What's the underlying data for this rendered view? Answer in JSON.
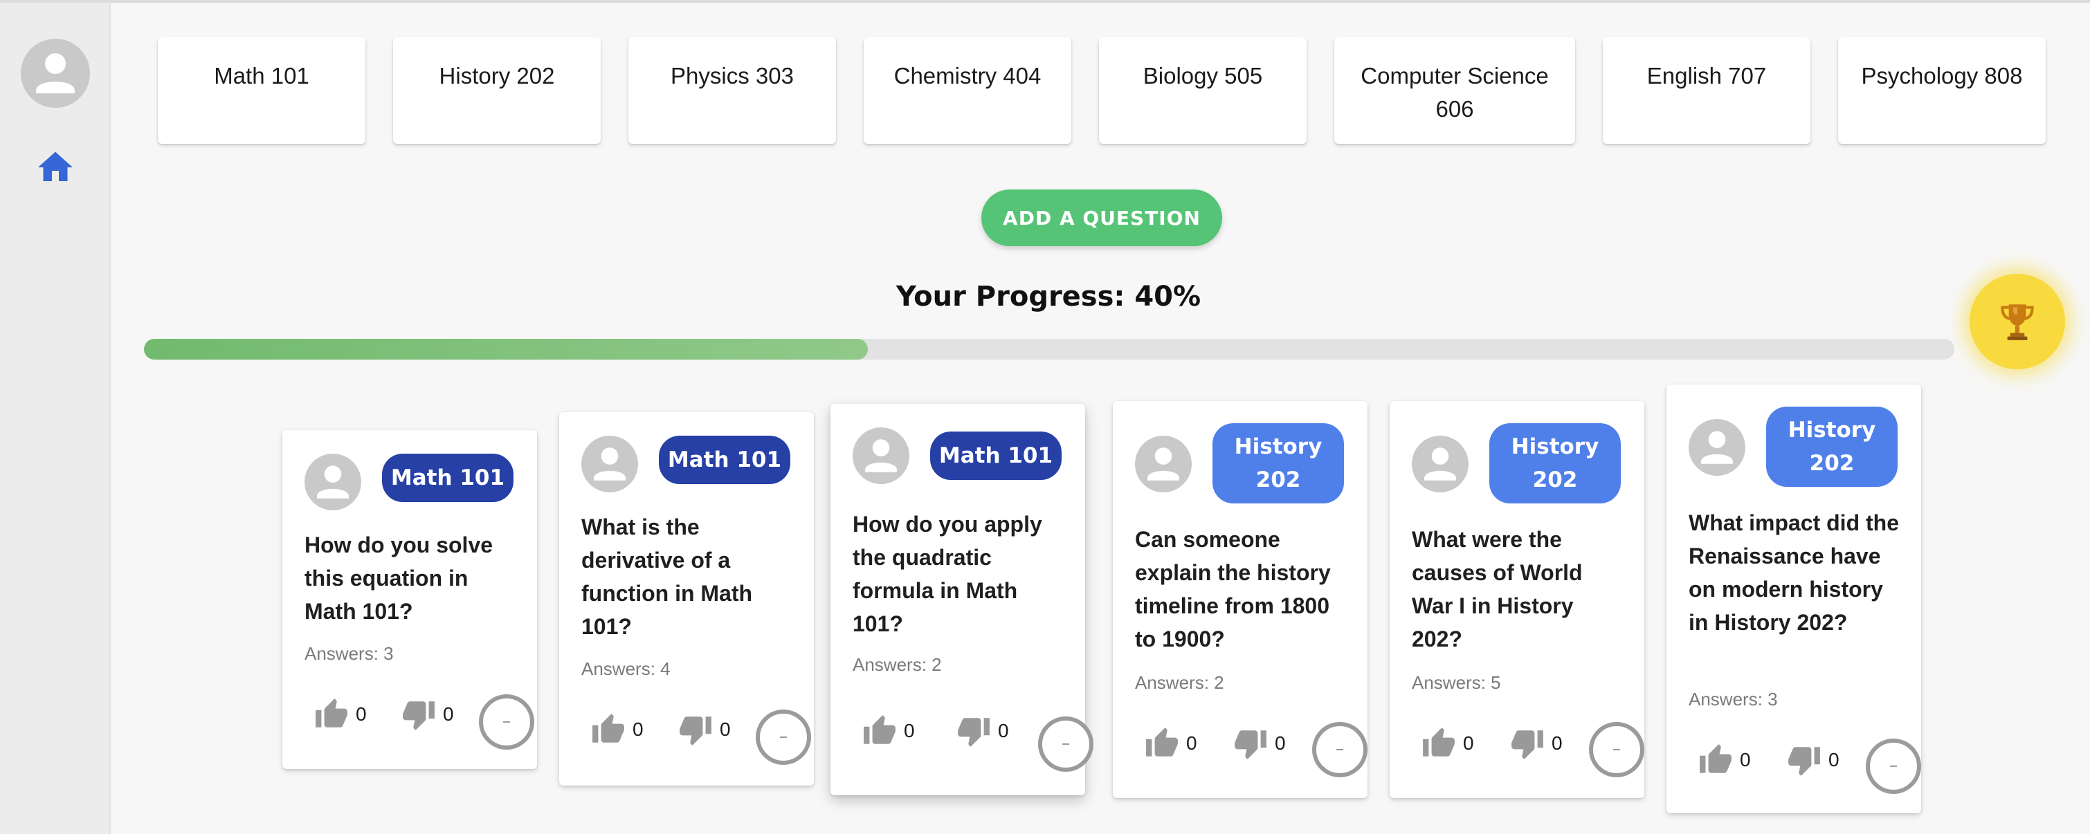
{
  "courses": [
    "Math 101",
    "History 202",
    "Physics 303",
    "Chemistry 404",
    "Biology 505",
    "Computer Science 606",
    "English 707",
    "Psychology 808"
  ],
  "actions": {
    "add_question": "ADD A QUESTION"
  },
  "progress": {
    "title": "Your Progress: 40%",
    "value": 0.4
  },
  "sidebar": {
    "avatar_icon": "user-avatar-icon",
    "home_icon": "home-icon"
  },
  "trophy_icon": "trophy-icon",
  "colors": {
    "accent_green": "#55c477",
    "progress_fill": "#7fbe7a",
    "badge_dark": "#2640a6",
    "badge_light": "#4f80e9",
    "trophy": "#f8d93e",
    "home_icon": "#3567d6"
  },
  "questions": [
    {
      "course": "Math 101",
      "text": "How do you solve this equation in Math 101?",
      "answers": "Answers: 3",
      "likes": "0",
      "dislikes": "0"
    },
    {
      "course": "Math 101",
      "text": "What is the derivative of a function in Math 101?",
      "answers": "Answers: 4",
      "likes": "0",
      "dislikes": "0"
    },
    {
      "course": "Math 101",
      "text": "How do you apply the quadratic formula in Math 101?",
      "answers": "Answers: 2",
      "likes": "0",
      "dislikes": "0"
    },
    {
      "course": "History 202",
      "text": "Can someone explain the history timeline from 1800 to 1900?",
      "answers": "Answers: 2",
      "likes": "0",
      "dislikes": "0"
    },
    {
      "course": "History 202",
      "text": "What were the causes of World War I in History 202?",
      "answers": "Answers: 5",
      "likes": "0",
      "dislikes": "0"
    },
    {
      "course": "History 202",
      "text": "What impact did the Renaissance have on modern history in History 202?",
      "answers": "Answers: 3",
      "likes": "0",
      "dislikes": "0"
    }
  ]
}
